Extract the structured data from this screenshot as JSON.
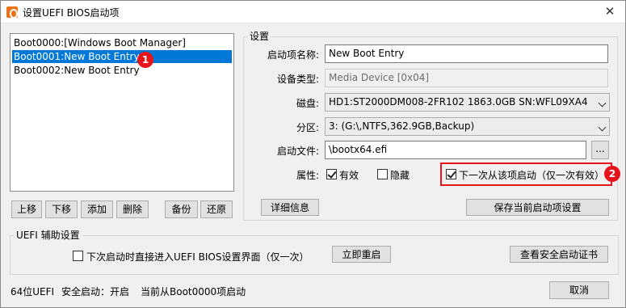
{
  "window": {
    "title": "设置UEFI BIOS启动项",
    "close_glyph": "✕",
    "app_icon": "app-logo-icon"
  },
  "boot_list": {
    "items": [
      {
        "label": "Boot0000:[Windows Boot Manager]",
        "selected": false
      },
      {
        "label": "Boot0001:New Boot Entry",
        "selected": true
      },
      {
        "label": "Boot0002:New Boot Entry",
        "selected": false
      }
    ],
    "badge": "1"
  },
  "list_buttons": {
    "up": "上移",
    "down": "下移",
    "add": "添加",
    "delete": "删除",
    "backup": "备份",
    "restore": "还原"
  },
  "settings": {
    "group_title": "设置",
    "name_label": "启动项名称:",
    "name_value": "New Boot Entry",
    "device_type_label": "设备类型:",
    "device_type_value": "Media Device [0x04]",
    "disk_label": "磁盘:",
    "disk_value": "HD1:ST2000DM008-2FR102 1863.0GB SN:WFL09XA4",
    "partition_label": "分区:",
    "partition_value": "3: (G:\\,NTFS,362.9GB,Backup)",
    "boot_file_label": "启动文件:",
    "boot_file_value": "\\bootx64.efi",
    "browse_label": "...",
    "attributes_label": "属性:",
    "valid_label": "有效",
    "valid_checked": true,
    "hidden_label": "隐藏",
    "hidden_checked": false,
    "next_once_label": "下一次从该项启动（仅一次有效）",
    "next_once_checked": true,
    "badge": "2",
    "details_button": "详细信息",
    "save_button": "保存当前启动项设置"
  },
  "uefi_helper": {
    "group_title": "UEFI 辅助设置",
    "enter_bios_label": "下次启动时直接进入UEFI BIOS设置界面（仅一次）",
    "enter_bios_checked": false,
    "restart_button": "立即重启",
    "secure_cert_button": "查看安全启动证书"
  },
  "status_bar": {
    "mode": "64位UEFI",
    "secure_boot": "安全启动：开启",
    "current_boot": "当前从Boot0000项启动",
    "cancel_button": "取消"
  },
  "colors": {
    "selection": "#0078d7",
    "badge": "#e8141b",
    "button_face": "#e1e1e1"
  }
}
